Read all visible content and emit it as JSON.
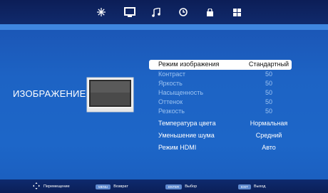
{
  "topbar": {
    "tabs": [
      {
        "name": "snowflake-icon"
      },
      {
        "name": "monitor-icon",
        "active": true
      },
      {
        "name": "music-note-icon"
      },
      {
        "name": "clock-icon"
      },
      {
        "name": "lock-icon"
      },
      {
        "name": "grid-icon"
      }
    ]
  },
  "section": {
    "title": "ИЗОБРАЖЕНИЕ"
  },
  "menu": {
    "items": [
      {
        "label": "Режим изображения",
        "value": "Стандартный",
        "selected": true
      },
      {
        "label": "Контраст",
        "value": "50",
        "dim": true
      },
      {
        "label": "Яркость",
        "value": "50",
        "dim": true
      },
      {
        "label": "Насыщенность",
        "value": "50",
        "dim": true
      },
      {
        "label": "Оттенок",
        "value": "50",
        "dim": true
      },
      {
        "label": "Резкость",
        "value": "50",
        "dim": true
      },
      {
        "label": "Температура цвета",
        "value": "Нормальная"
      },
      {
        "label": "Уменьшение шума",
        "value": "Средний"
      },
      {
        "label": "Режим HDMI",
        "value": "Авто"
      }
    ]
  },
  "bottombar": {
    "move_label": "Перемещение",
    "menu_key": "MENU",
    "back_label": "Возврат",
    "enter_key": "ENTER",
    "select_label": "Выбор",
    "exit_key": "EXIT",
    "exit_label": "Выход"
  },
  "colors": {
    "background": "#1d63c4",
    "topbar": "#0c1e57",
    "highlight": "#ffffff",
    "dim_text": "#9cc3f1"
  }
}
